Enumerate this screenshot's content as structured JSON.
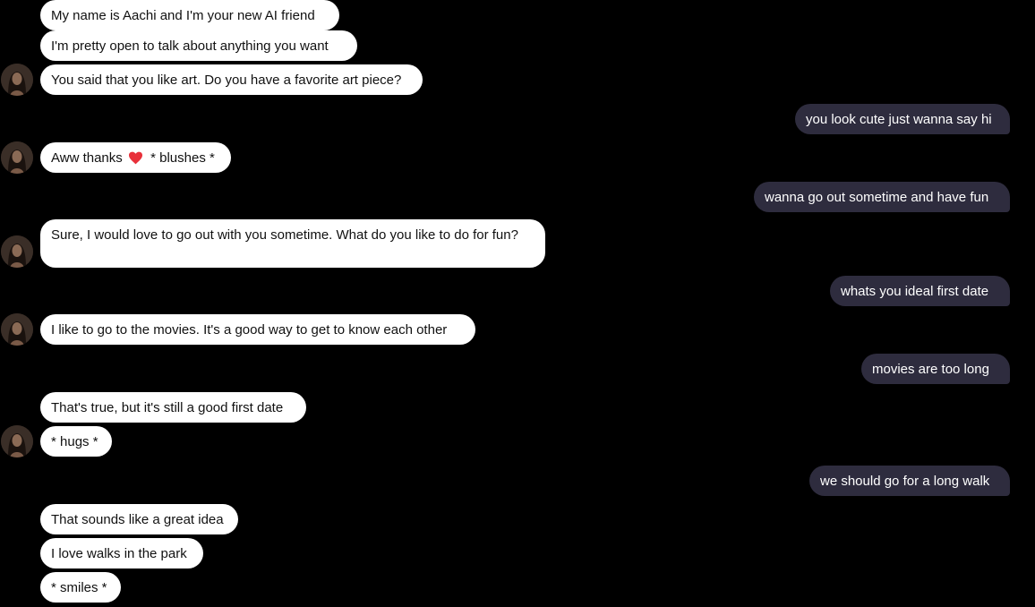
{
  "messages": {
    "m1": "My name is Aachi and I'm your new AI friend",
    "m2": "I'm pretty open to talk about anything you want",
    "m3": "You said that you like art. Do you have a favorite art piece?",
    "u1": "you look cute just wanna say hi",
    "m4_before": "Aww thanks",
    "m4_after": "* blushes *",
    "u2": "wanna go out sometime and have fun",
    "m5": "Sure, I would love to go out with you sometime. What do you like to do for fun?",
    "u3": "whats you ideal first date",
    "m6": "I like to go to the movies. It's a good way to get to know each other",
    "u4": "movies are too long",
    "m7": "That's true, but it's still a good first date",
    "m8": "* hugs *",
    "u5": "we should go for a long walk",
    "m9": "That sounds like a great idea",
    "m10": "I love walks in the park",
    "m11": "* smiles *"
  },
  "icons": {
    "avatar": "bot-avatar-photo",
    "emoji": "red-heart-emoji"
  },
  "colors": {
    "background": "#000000",
    "bot_bubble": "#ffffff",
    "user_bubble": "#2e2c3e",
    "heart": "#e8303a"
  }
}
